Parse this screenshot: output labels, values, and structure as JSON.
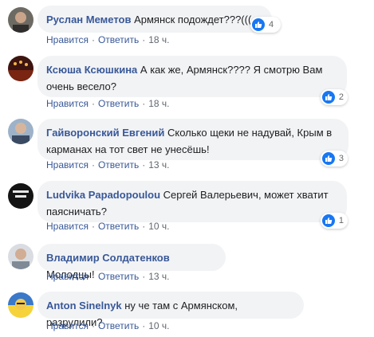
{
  "actions": {
    "like": "Нравится",
    "reply": "Ответить"
  },
  "comments": [
    {
      "author": "Руслан Меметов",
      "text": "Армянск подождет???(((",
      "time": "18 ч.",
      "likes": "4"
    },
    {
      "author": "Ксюша Ксюшкина",
      "text_line1": "А как же, Армянск???? Я смотрю Вам",
      "text_line2": "очень весело?",
      "time": "18 ч.",
      "likes": "2"
    },
    {
      "author": "Гайворонский Евгений",
      "text_line1": "Сколько щеки не надувай, Крым в",
      "text_line2": "карманах на тот свет не унесёшь!",
      "time": "13 ч.",
      "likes": "3"
    },
    {
      "author": "Ludvika Papadopoulou",
      "text_line1": "Сергей Валерьевич, может хватит",
      "text_line2": "паясничать?",
      "time": "10 ч.",
      "likes": "1"
    },
    {
      "author": "Владимир Солдатенков",
      "text": "Молодцы!",
      "time": "13 ч."
    },
    {
      "author": "Anton Sinelnyk",
      "text": "ну че там с Армянском, разрулили?",
      "time": "10 ч."
    }
  ],
  "colors": {
    "link": "#385898",
    "bubble": "#f2f3f5",
    "like": "#1877f2"
  },
  "icons": {
    "like": "thumbs-up-icon"
  }
}
